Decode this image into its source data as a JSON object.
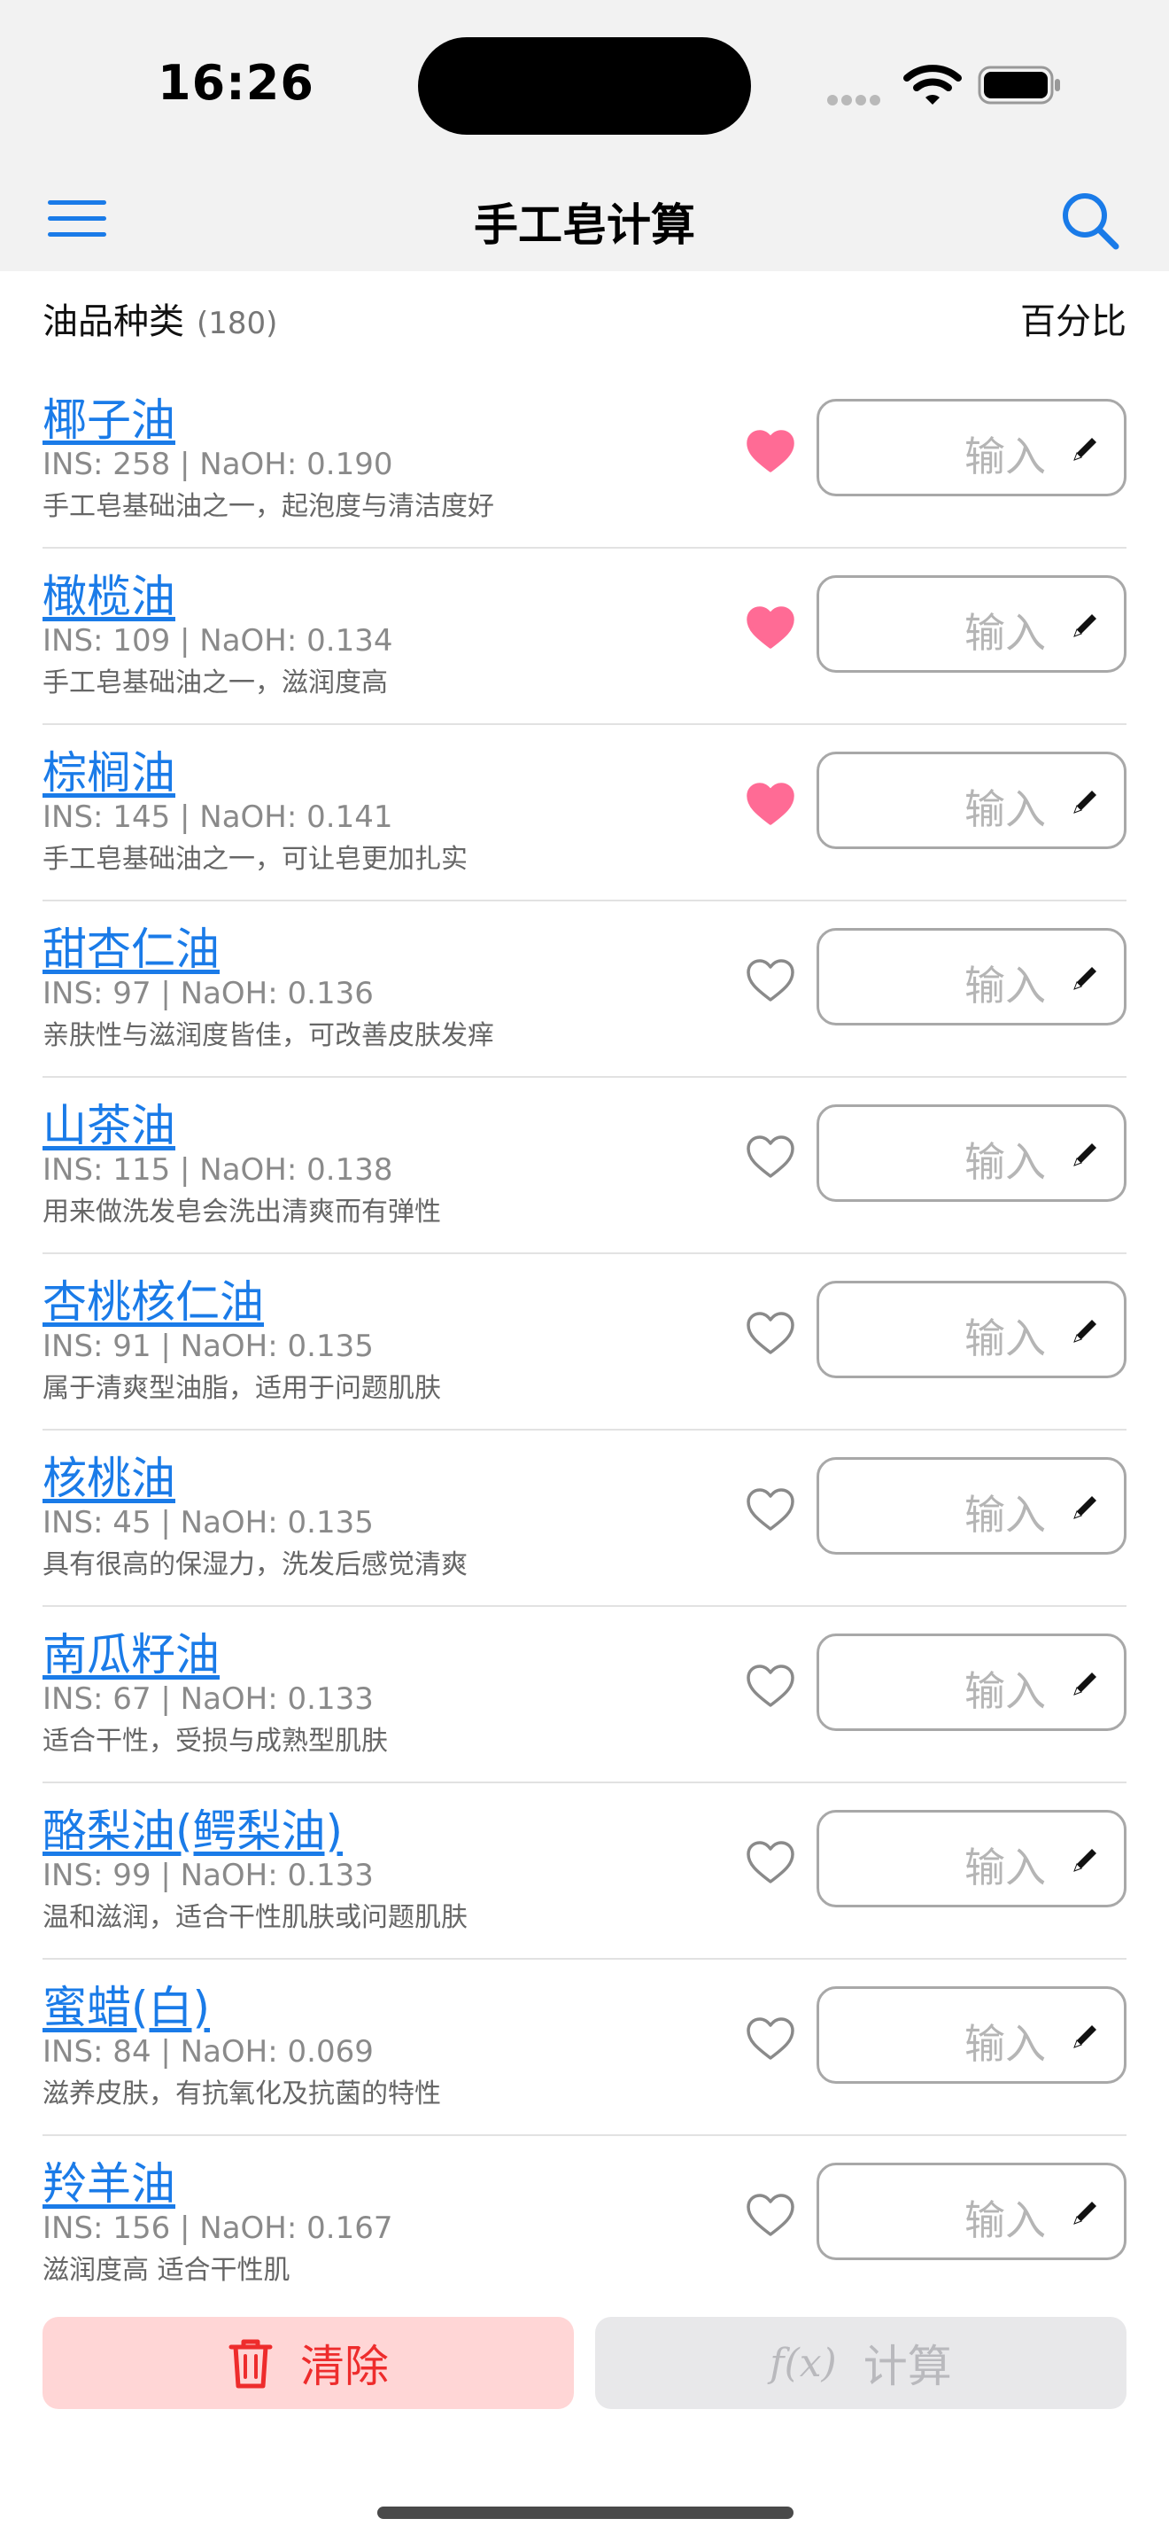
{
  "status_bar": {
    "time": "16:26"
  },
  "nav": {
    "title": "手工皂计算",
    "menu_icon": "hamburger-menu-icon",
    "search_icon": "search-icon"
  },
  "list_header": {
    "title": "油品种类",
    "count": "(180)",
    "percent_label": "百分比"
  },
  "oils": [
    {
      "name": "椰子油",
      "stats": "INS: 258 | NaOH: 0.190",
      "desc": "手工皂基础油之一，起泡度与清洁度好",
      "favorite": true,
      "placeholder": "输入"
    },
    {
      "name": "橄榄油",
      "stats": "INS: 109 | NaOH: 0.134",
      "desc": "手工皂基础油之一，滋润度高",
      "favorite": true,
      "placeholder": "输入"
    },
    {
      "name": "棕榈油",
      "stats": "INS: 145 | NaOH: 0.141",
      "desc": "手工皂基础油之一，可让皂更加扎实",
      "favorite": true,
      "placeholder": "输入"
    },
    {
      "name": "甜杏仁油",
      "stats": "INS: 97 | NaOH: 0.136",
      "desc": "亲肤性与滋润度皆佳，可改善皮肤发痒",
      "favorite": false,
      "placeholder": "输入"
    },
    {
      "name": "山茶油",
      "stats": "INS: 115 | NaOH: 0.138",
      "desc": "用来做洗发皂会洗出清爽而有弹性",
      "favorite": false,
      "placeholder": "输入"
    },
    {
      "name": "杏桃核仁油",
      "stats": "INS: 91 | NaOH: 0.135",
      "desc": "属于清爽型油脂，适用于问题肌肤",
      "favorite": false,
      "placeholder": "输入"
    },
    {
      "name": "核桃油",
      "stats": "INS: 45 | NaOH: 0.135",
      "desc": "具有很高的保湿力，洗发后感觉清爽",
      "favorite": false,
      "placeholder": "输入"
    },
    {
      "name": "南瓜籽油",
      "stats": "INS: 67 | NaOH: 0.133",
      "desc": "适合干性，受损与成熟型肌肤",
      "favorite": false,
      "placeholder": "输入"
    },
    {
      "name": "酪梨油(鳄梨油)",
      "stats": "INS: 99 | NaOH: 0.133",
      "desc": "温和滋润，适合干性肌肤或问题肌肤",
      "favorite": false,
      "placeholder": "输入"
    },
    {
      "name": "蜜蜡(白)",
      "stats": "INS: 84 | NaOH: 0.069",
      "desc": "滋养皮肤，有抗氧化及抗菌的特性",
      "favorite": false,
      "placeholder": "输入"
    },
    {
      "name": "羚羊油",
      "stats": "INS: 156 | NaOH: 0.167",
      "desc": "滋润度高 适合干性肌",
      "favorite": false,
      "placeholder": "输入"
    }
  ],
  "actions": {
    "clear_label": "清除",
    "clear_icon": "trash-icon",
    "calc_label": "计算",
    "calc_icon": "function-fx-icon",
    "calc_icon_text": "f(x)"
  },
  "colors": {
    "accent": "#1a7be8",
    "favorite": "#ff6b95",
    "clear_bg": "#ffd6d6",
    "clear_text": "#ee2c2c",
    "disabled_bg": "#e8e8ea"
  }
}
